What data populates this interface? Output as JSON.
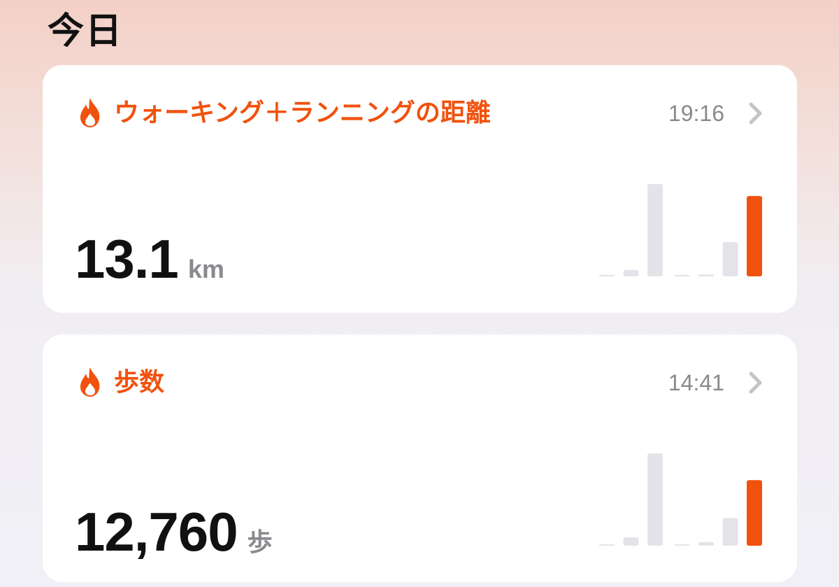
{
  "page": {
    "section_title": "今日"
  },
  "colors": {
    "accent": "#F0520E",
    "bar_inactive": "#E4E3EA",
    "secondary_text": "#8A8A8E"
  },
  "cards": [
    {
      "title": "ウォーキング＋ランニングの距離",
      "time": "19:16",
      "value": "13.1",
      "unit": "km",
      "icon": "flame-icon",
      "bars": [
        0.01,
        0.07,
        1.0,
        0.0,
        0.02,
        0.37,
        0.87
      ],
      "highlight_index": 6
    },
    {
      "title": "歩数",
      "time": "14:41",
      "value": "12,760",
      "unit": "歩",
      "icon": "flame-icon",
      "bars": [
        0.01,
        0.09,
        1.0,
        0.01,
        0.04,
        0.3,
        0.71
      ],
      "highlight_index": 6
    }
  ]
}
